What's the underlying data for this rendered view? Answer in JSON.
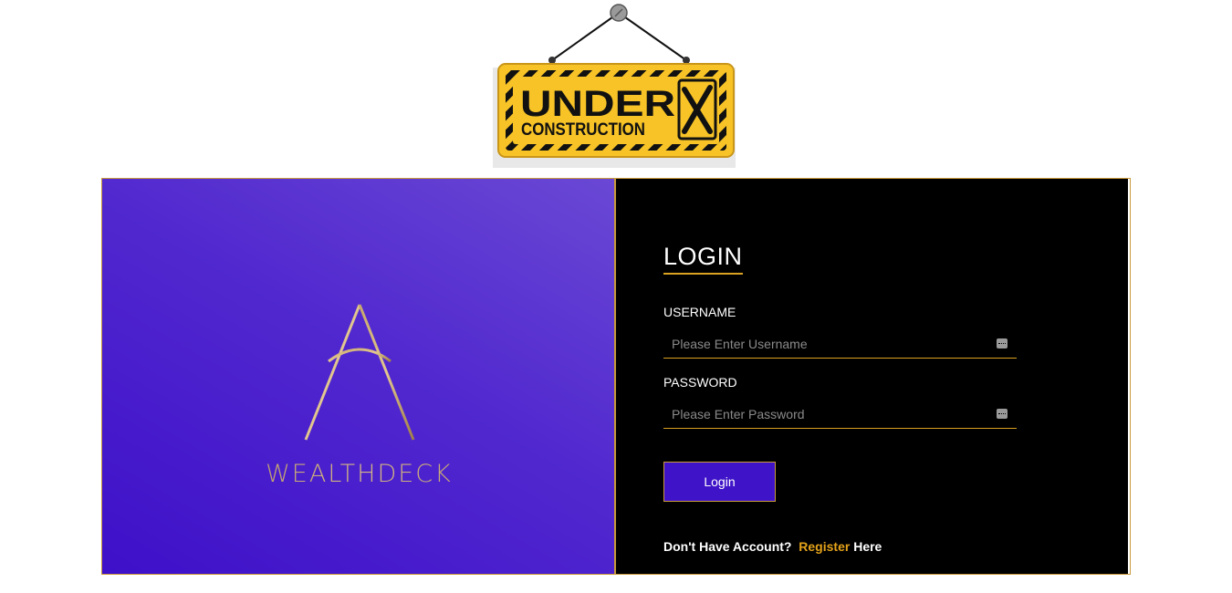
{
  "sign": {
    "line1": "UNDER",
    "line2": "CONSTRUCTION"
  },
  "brand": {
    "name": "WEALTHDECK"
  },
  "login": {
    "title": "LOGIN",
    "username_label": "USERNAME",
    "username_placeholder": "Please Enter Username",
    "password_label": "PASSWORD",
    "password_placeholder": "Please Enter Password",
    "submit_label": "Login",
    "no_account_text": "Don't Have Account?",
    "register_link": "Register",
    "register_suffix": "Here"
  },
  "colors": {
    "accent_gold": "#d9a222",
    "brand_purple": "#3f14c8",
    "panel_black": "#000000",
    "sign_yellow": "#f7c326"
  }
}
